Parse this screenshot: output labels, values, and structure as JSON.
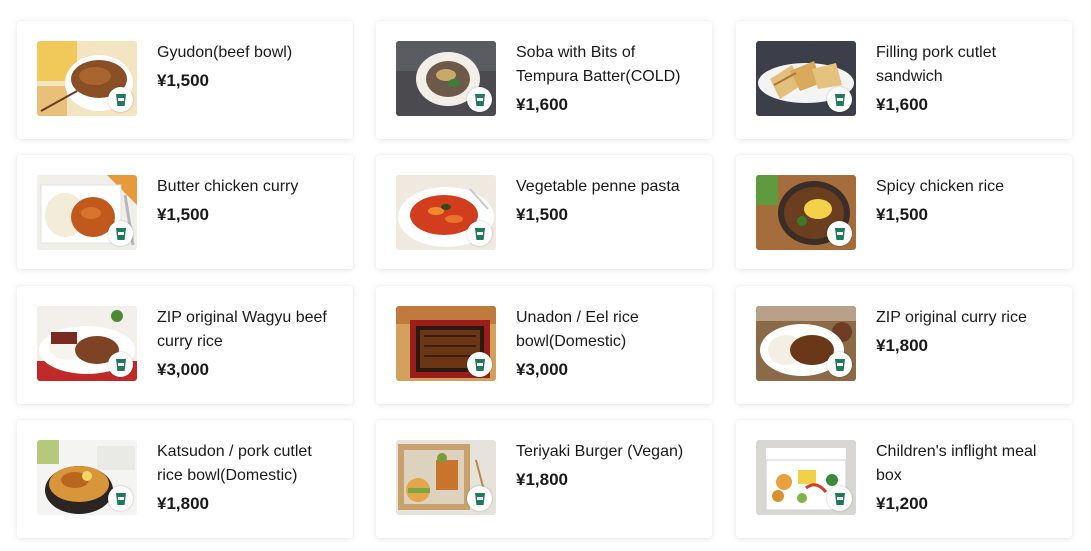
{
  "colors": {
    "accent": "#1f7a5c",
    "card_bg": "#ffffff",
    "text": "#1a1a1a"
  },
  "menu": {
    "items": [
      {
        "name": "Gyudon(beef bowl)",
        "price": "¥1,500",
        "icon": "to-go-cup-icon",
        "photo": "beef-bowl"
      },
      {
        "name": "Soba with Bits of Tempura Batter(COLD)",
        "price": "¥1,600",
        "icon": "to-go-cup-icon",
        "photo": "soba"
      },
      {
        "name": "Filling pork cutlet sandwich",
        "price": "¥1,600",
        "icon": "to-go-cup-icon",
        "photo": "sandwich"
      },
      {
        "name": "Butter chicken curry",
        "price": "¥1,500",
        "icon": "to-go-cup-icon",
        "photo": "curry"
      },
      {
        "name": "Vegetable penne pasta",
        "price": "¥1,500",
        "icon": "to-go-cup-icon",
        "photo": "pasta"
      },
      {
        "name": "Spicy chicken rice",
        "price": "¥1,500",
        "icon": "to-go-cup-icon",
        "photo": "chicken-rice"
      },
      {
        "name": "ZIP original Wagyu beef curry rice",
        "price": "¥3,000",
        "icon": "to-go-cup-icon",
        "photo": "wagyu-curry"
      },
      {
        "name": "Unadon / Eel rice bowl(Domestic)",
        "price": "¥3,000",
        "icon": "to-go-cup-icon",
        "photo": "unadon"
      },
      {
        "name": "ZIP original curry rice",
        "price": "¥1,800",
        "icon": "to-go-cup-icon",
        "photo": "curry-rice"
      },
      {
        "name": "Katsudon / pork cutlet rice bowl(Domestic)",
        "price": "¥1,800",
        "icon": "to-go-cup-icon",
        "photo": "katsudon"
      },
      {
        "name": "Teriyaki Burger (Vegan)",
        "price": "¥1,800",
        "icon": "to-go-cup-icon",
        "photo": "burger"
      },
      {
        "name": "Children's inflight meal box",
        "price": "¥1,200",
        "icon": "to-go-cup-icon",
        "photo": "kids-box"
      }
    ]
  }
}
